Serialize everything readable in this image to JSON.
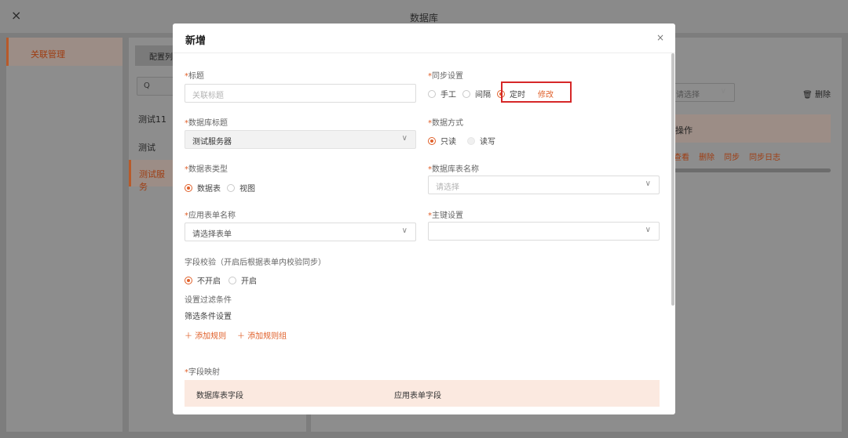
{
  "window": {
    "title": "数据库",
    "close_icon": "×"
  },
  "sidebar": {
    "items": [
      {
        "label": "关联管理"
      }
    ]
  },
  "middle_panel": {
    "tab_label": "配置列",
    "search_icon": "Q",
    "list": [
      {
        "label": "测试11"
      },
      {
        "label": "测试"
      },
      {
        "label": "测试服务"
      }
    ]
  },
  "right_panel": {
    "select_placeholder": "请选择",
    "delete_label": "删除",
    "table_header": "操作",
    "row_actions": [
      "查看",
      "删除",
      "同步",
      "同步日志"
    ]
  },
  "modal": {
    "title": "新增",
    "close_icon": "×",
    "fields": {
      "title": {
        "label": "标题",
        "placeholder": "关联标题"
      },
      "sync": {
        "label": "同步设置",
        "options": [
          "手工",
          "间隔",
          "定时"
        ],
        "selected": "定时",
        "modify_label": "修改"
      },
      "db_title": {
        "label": "数据库标题",
        "value": "测试服务器"
      },
      "data_mode": {
        "label": "数据方式",
        "options": [
          "只读",
          "读写"
        ],
        "selected": "只读"
      },
      "table_type": {
        "label": "数据表类型",
        "options": [
          "数据表",
          "视图"
        ],
        "selected": "数据表"
      },
      "db_table_name": {
        "label": "数据库表名称",
        "placeholder": "请选择"
      },
      "form_name": {
        "label": "应用表单名称",
        "placeholder": "请选择表单"
      },
      "primary_key": {
        "label": "主键设置",
        "value": ""
      },
      "field_check": {
        "label": "字段校验（开启后根据表单内校验同步）",
        "options": [
          "不开启",
          "开启"
        ],
        "selected": "不开启"
      },
      "filter": {
        "label": "设置过滤条件",
        "sub_label": "筛选条件设置",
        "add_rule": "添加规则",
        "add_group": "添加规则组"
      },
      "mapping": {
        "label": "字段映射",
        "col1": "数据库表字段",
        "col2": "应用表单字段"
      }
    },
    "accent_color": "#e0602a",
    "highlight_color": "#d62728"
  }
}
